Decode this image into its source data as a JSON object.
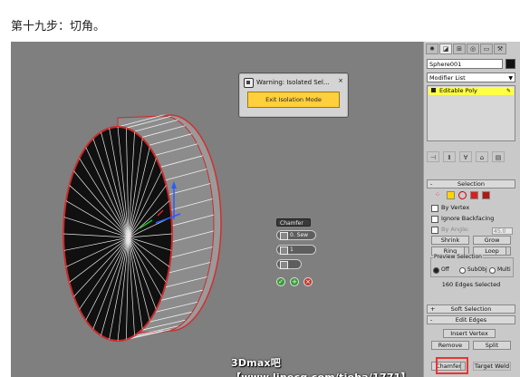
{
  "caption": "第十九步：切角。",
  "warning_dialog": {
    "title": "Warning: Isolated Sel...",
    "close_symbol": "×",
    "exit_button": "Exit Isolation Mode"
  },
  "caddy": {
    "title": "Chamfer",
    "amount": "0. Sew",
    "segments": "1",
    "ok_symbol": "✓",
    "apply_symbol": "+",
    "cancel_symbol": "×"
  },
  "watermark": "3Dmax吧 【www.linecg.com/tieba/1771】",
  "command_panel": {
    "tabs": [
      "create-icon",
      "modify-icon",
      "hierarchy-icon",
      "motion-icon",
      "display-icon",
      "utilities-icon"
    ],
    "object_name": "Sphere001",
    "object_color": "#111111",
    "modifier_list": "Modifier List",
    "stack_item": "Editable Poly",
    "selection_rollout": "Selection",
    "by_vertex": "By Vertex",
    "ignore_backfacing": "Ignore Backfacing",
    "by_angle": "By Angle:",
    "angle_value": "45.0",
    "shrink": "Shrink",
    "grow": "Grow",
    "ring": "Ring",
    "loop": "Loop",
    "preview_selection": "Preview Selection",
    "preview_off": "Off",
    "preview_subobj": "SubObj",
    "preview_multi": "Multi",
    "selection_status": "160 Edges Selected",
    "soft_selection": "Soft Selection",
    "edit_edges": "Edit Edges",
    "insert_vertex": "Insert Vertex",
    "remove": "Remove",
    "split": "Split",
    "chamfer": "Chamfer",
    "target_weld": "Target Weld",
    "rollout_plus": "+",
    "rollout_minus": "-"
  },
  "colors": {
    "viewport_bg": "#7f7f7f",
    "highlight": "#ffff48",
    "exit_button": "#ffcf3c",
    "selection_edge": "#e02020"
  }
}
